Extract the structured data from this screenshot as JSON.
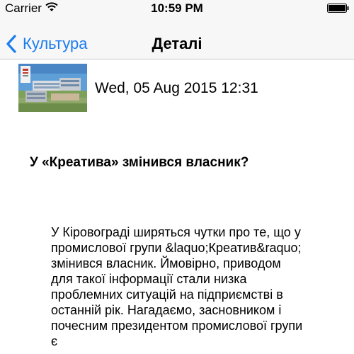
{
  "status": {
    "carrier": "Carrier",
    "time": "10:59 PM"
  },
  "nav": {
    "back_label": "Культура",
    "title": "Деталі"
  },
  "article": {
    "date": "Wed, 05 Aug 2015 12:31",
    "headline": "У «Креатива» змінився власник?",
    "body": "У Кіровограді ширяться чутки про те, що у промислової групи &laquo;Креатив&raquo; змінився власник. Ймовірно, приводом для такої інформації стали низка проблемних ситуацій на підприємстві в останній рік. Нагадаємо, засновником і почесним президентом промислової групи є"
  },
  "colors": {
    "accent": "#1a7cf0",
    "bar_background": "#f7f7f7",
    "separator": "#c8c7cc"
  },
  "icons": {
    "wifi": "wifi-icon",
    "battery": "battery-icon",
    "back": "chevron-left-icon"
  }
}
